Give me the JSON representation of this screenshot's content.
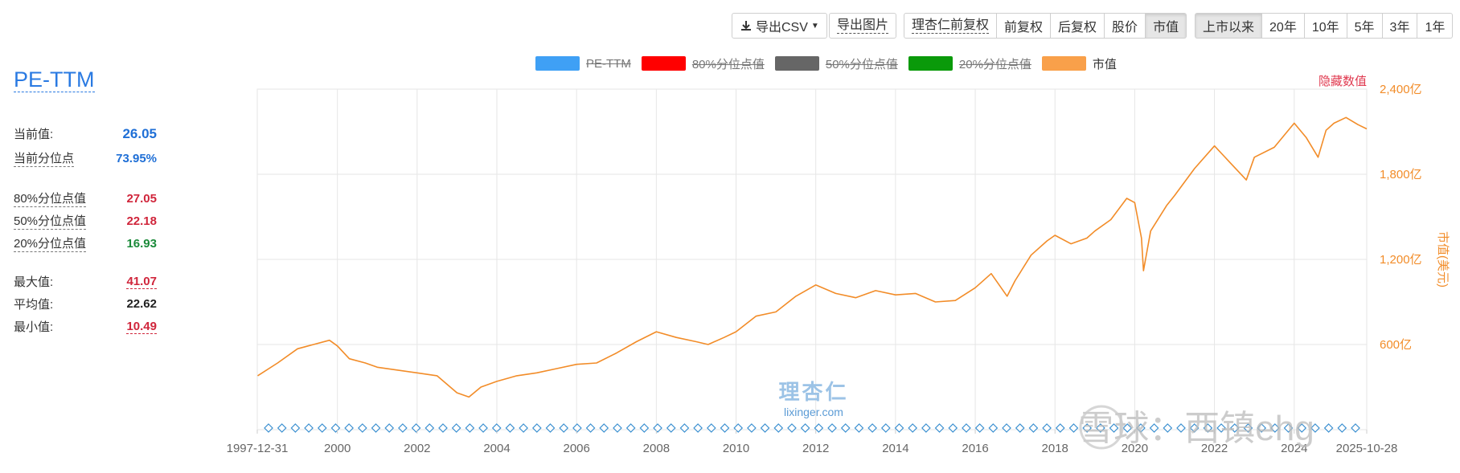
{
  "toolbar": {
    "export_csv": "导出CSV",
    "export_image": "导出图片",
    "adjust": [
      "理杏仁前复权",
      "前复权",
      "后复权",
      "股价",
      "市值"
    ],
    "adjust_active": "市值",
    "ranges": [
      "上市以来",
      "20年",
      "10年",
      "5年",
      "3年",
      "1年"
    ],
    "range_active": "上市以来"
  },
  "legend": [
    {
      "label": "PE-TTM",
      "color": "#3fa0f5",
      "visible": false
    },
    {
      "label": "80%分位点值",
      "color": "#ff0000",
      "visible": false
    },
    {
      "label": "50%分位点值",
      "color": "#666666",
      "visible": false
    },
    {
      "label": "20%分位点值",
      "color": "#0a9a0a",
      "visible": false
    },
    {
      "label": "市值",
      "color": "#f9a04a",
      "visible": true
    }
  ],
  "stats": {
    "title": "PE-TTM",
    "current_label": "当前值:",
    "current": "26.05",
    "current_pct_label": "当前分位点",
    "current_pct": "73.95%",
    "p80_label": "80%分位点值",
    "p80": "27.05",
    "p50_label": "50%分位点值",
    "p50": "22.18",
    "p20_label": "20%分位点值",
    "p20": "16.93",
    "max_label": "最大值:",
    "max": "41.07",
    "avg_label": "平均值:",
    "avg": "22.62",
    "min_label": "最小值:",
    "min": "10.49"
  },
  "hide_values_label": "隐藏数值",
  "watermark": {
    "cn": "理杏仁",
    "en": "lixinger.com",
    "overlay": "雪球：西镇ehg"
  },
  "colors": {
    "marketcap": "#f28c28",
    "pe_marker": "#3a8fd0",
    "grid": "#e6e6e6",
    "accent_blue": "#2a7ae2"
  },
  "chart_data": {
    "type": "line",
    "title": "",
    "xlabel": "",
    "ylabel_right": "市值(美元)",
    "x_tick_labels": [
      "1997-12-31",
      "2000",
      "2002",
      "2004",
      "2006",
      "2008",
      "2010",
      "2012",
      "2014",
      "2016",
      "2018",
      "2020",
      "2022",
      "2024",
      "2025-10-28"
    ],
    "x_range": [
      1997.99,
      2025.82
    ],
    "y_right_ticks": [
      "600亿",
      "1,200亿",
      "1,800亿",
      "2,400亿"
    ],
    "y_right_range": [
      0,
      2400
    ],
    "grid": true,
    "series": [
      {
        "name": "市值",
        "axis": "right",
        "x": [
          1998.0,
          1998.5,
          1999.0,
          1999.4,
          1999.8,
          2000.0,
          2000.3,
          2000.7,
          2001.0,
          2001.5,
          2002.0,
          2002.5,
          2003.0,
          2003.3,
          2003.6,
          2004.0,
          2004.5,
          2005.0,
          2005.5,
          2006.0,
          2006.5,
          2007.0,
          2007.5,
          2008.0,
          2008.5,
          2009.0,
          2009.3,
          2009.7,
          2010.0,
          2010.5,
          2011.0,
          2011.5,
          2012.0,
          2012.5,
          2013.0,
          2013.5,
          2014.0,
          2014.5,
          2015.0,
          2015.5,
          2016.0,
          2016.4,
          2016.8,
          2017.0,
          2017.4,
          2017.8,
          2018.0,
          2018.4,
          2018.8,
          2019.0,
          2019.4,
          2019.8,
          2020.0,
          2020.17,
          2020.22,
          2020.4,
          2020.8,
          2021.0,
          2021.5,
          2022.0,
          2022.4,
          2022.8,
          2023.0,
          2023.5,
          2024.0,
          2024.3,
          2024.6,
          2024.8,
          2025.0,
          2025.3,
          2025.6,
          2025.82
        ],
        "values": [
          380,
          470,
          570,
          600,
          630,
          590,
          500,
          470,
          440,
          420,
          400,
          380,
          260,
          230,
          300,
          340,
          380,
          400,
          430,
          460,
          470,
          540,
          620,
          690,
          650,
          620,
          600,
          650,
          690,
          800,
          830,
          940,
          1020,
          960,
          930,
          980,
          950,
          960,
          900,
          910,
          1000,
          1100,
          940,
          1050,
          1230,
          1330,
          1370,
          1310,
          1350,
          1400,
          1480,
          1630,
          1600,
          1350,
          1120,
          1400,
          1580,
          1650,
          1840,
          2000,
          1880,
          1760,
          1920,
          1990,
          2160,
          2060,
          1920,
          2110,
          2160,
          2200,
          2150,
          2120
        ]
      },
      {
        "name": "PE-TTM",
        "axis": "left",
        "hidden": true,
        "marker_count": 82
      }
    ]
  }
}
